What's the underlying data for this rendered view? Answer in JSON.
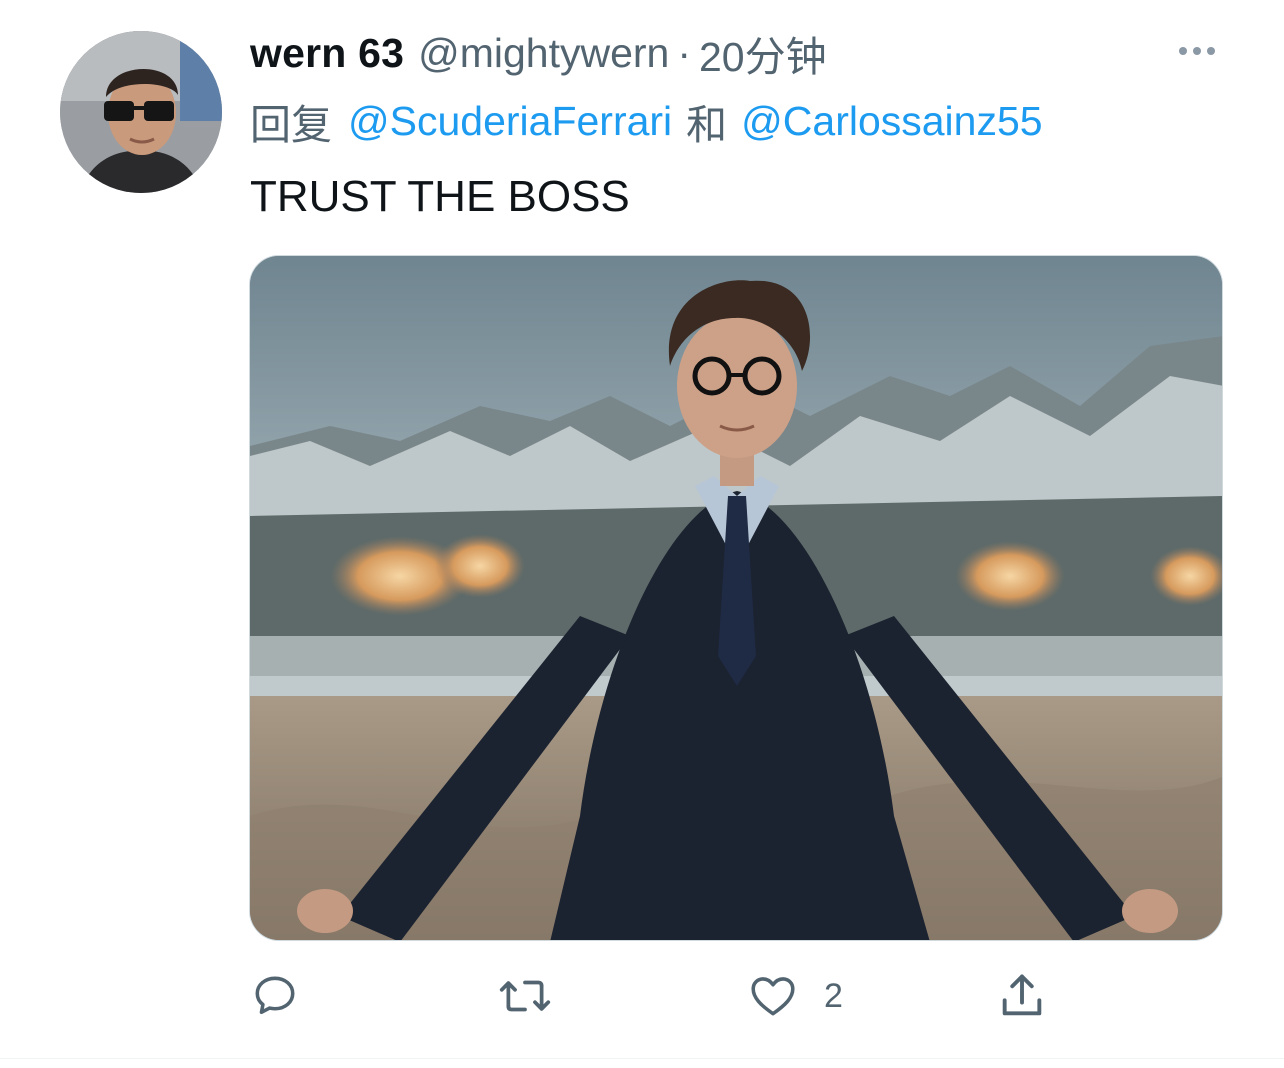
{
  "tweet": {
    "author": {
      "display_name": "wern 63",
      "handle": "@mightywern"
    },
    "separator": "·",
    "timestamp": "20分钟",
    "reply": {
      "prefix": "回复",
      "mentions": [
        "@ScuderiaFerrari",
        "@Carlossainz55"
      ],
      "conjunction": "和"
    },
    "text": "TRUST THE BOSS",
    "actions": {
      "reply_count": "",
      "retweet_count": "",
      "like_count": "2",
      "share_count": ""
    },
    "icons": {
      "more": "more-horizontal-icon",
      "reply": "comment-icon",
      "retweet": "retweet-icon",
      "like": "heart-icon",
      "share": "share-icon"
    },
    "colors": {
      "text": "#0f1419",
      "secondary": "#536471",
      "mention": "#1d9bf0",
      "icon": "#536471"
    }
  }
}
